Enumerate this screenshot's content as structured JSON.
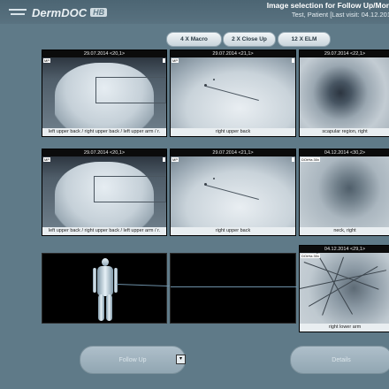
{
  "app": {
    "logo_text": "DermDOC",
    "logo_badge": "HB",
    "title": "Image selection for Follow Up/Mon",
    "subtitle": "Test, Patient [Last visit: 04.12.201"
  },
  "modes": [
    {
      "label": "4 X Macro"
    },
    {
      "label": "2 X Close Up"
    },
    {
      "label": "12 X ELM"
    }
  ],
  "row1": [
    {
      "date": "29.07.2014 <20,1>",
      "caption": "left upper back / right upper back / left upper arm / r.",
      "tag": "MP"
    },
    {
      "date": "29.07.2014 <21,1>",
      "caption": "right upper back",
      "tag": "MP"
    },
    {
      "date": "29.07.2014 <22,1>",
      "caption": "scapular region, right",
      "tag": ""
    }
  ],
  "row2": [
    {
      "date": "29.07.2014 <20,1>",
      "caption": "left upper back / right upper back / left upper arm / r.",
      "tag": "MP"
    },
    {
      "date": "29.07.2014 <21,1>",
      "caption": "right upper back",
      "tag": "MP"
    },
    {
      "date": "04.12.2014 <30,2>",
      "caption": "neck, right",
      "tag": "DOrHa 30x"
    }
  ],
  "row3": {
    "dermo": {
      "date": "04.12.2014 <29,1>",
      "caption": "right lower arm",
      "tag": "DOrHa 30x"
    }
  },
  "actions": {
    "follow_up": "Follow Up",
    "details": "Details",
    "dropdown": "▾"
  }
}
